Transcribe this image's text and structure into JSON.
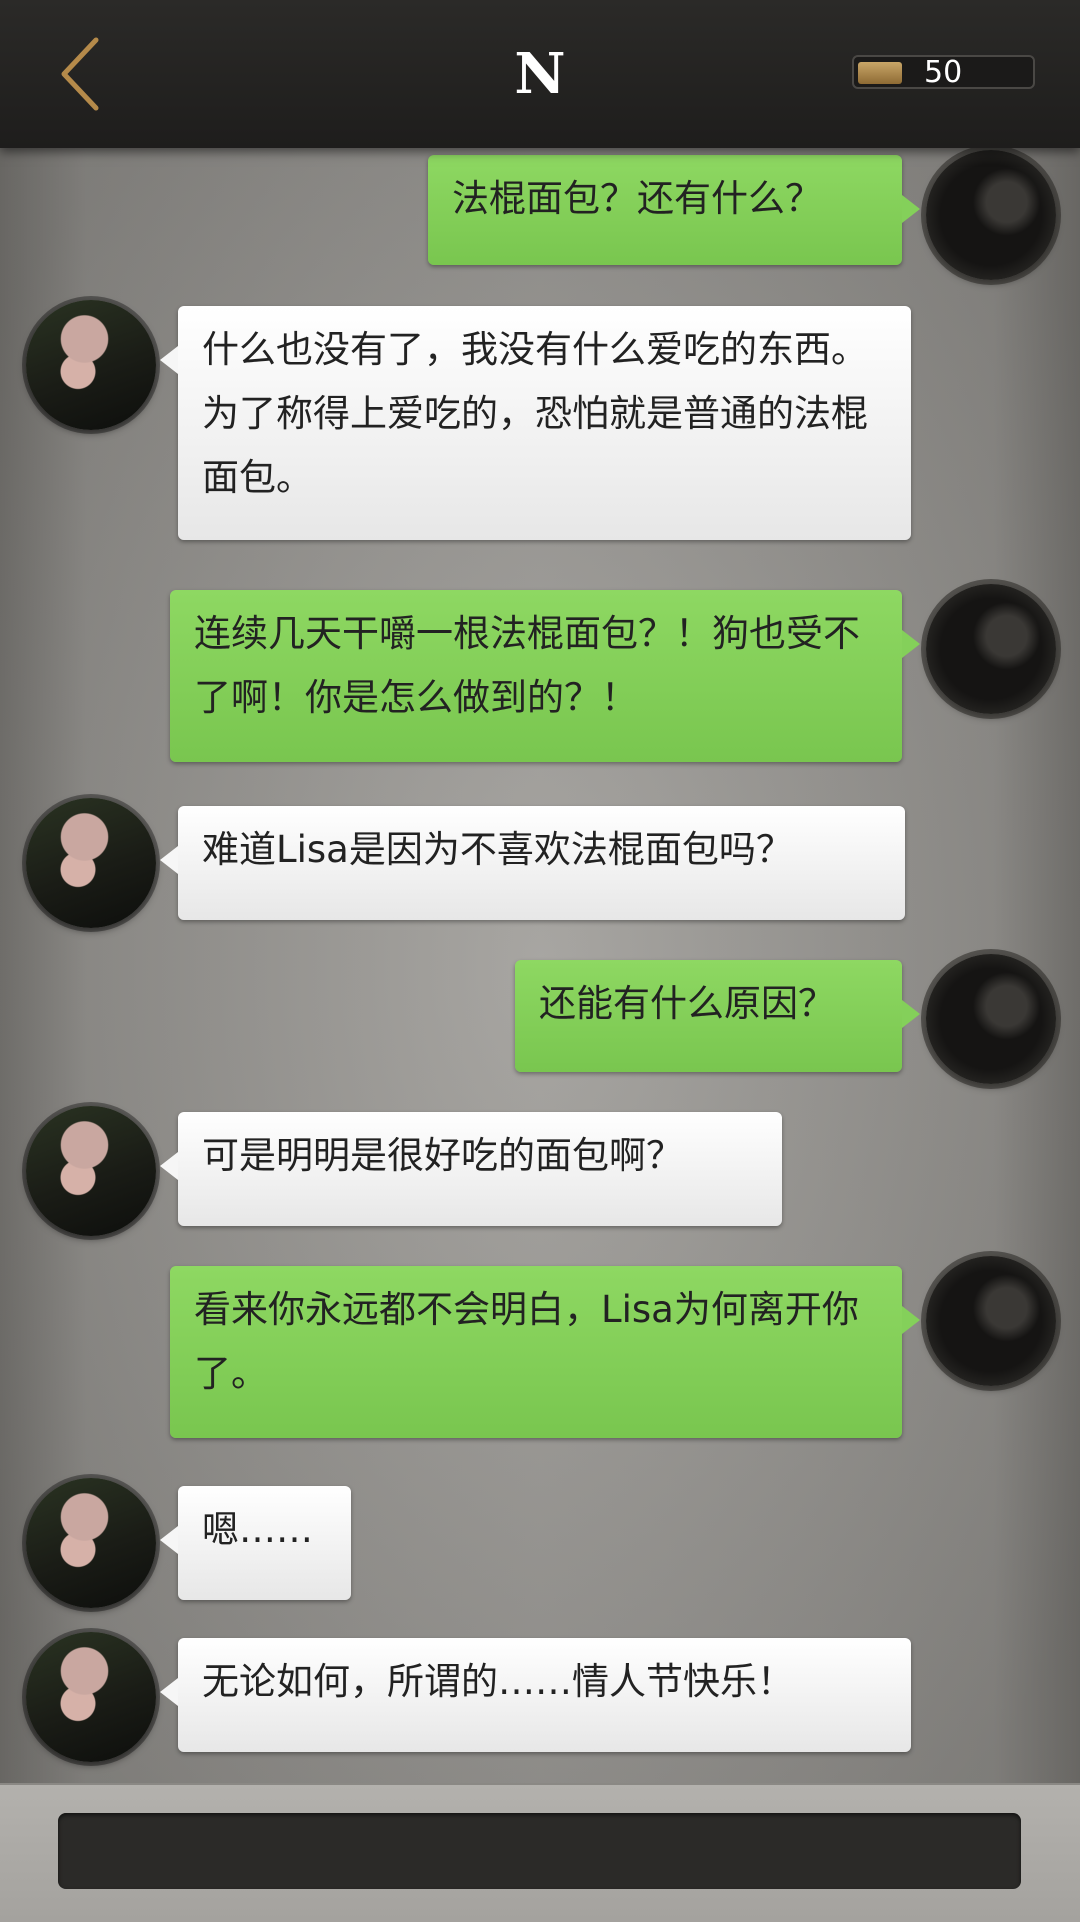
{
  "header": {
    "title": "N",
    "coin_count": "50"
  },
  "messages": [
    {
      "sender": "me",
      "text": "法棍面包？还有什么？"
    },
    {
      "sender": "npc",
      "text": "什么也没有了，我没有什么爱吃的东西。为了称得上爱吃的，恐怕就是普通的法棍面包。"
    },
    {
      "sender": "me",
      "text": "连续几天干嚼一根法棍面包？！狗也受不了啊！你是怎么做到的？！"
    },
    {
      "sender": "npc",
      "text": "难道Lisa是因为不喜欢法棍面包吗？"
    },
    {
      "sender": "me",
      "text": "还能有什么原因？"
    },
    {
      "sender": "npc",
      "text": "可是明明是很好吃的面包啊？"
    },
    {
      "sender": "me",
      "text": "看来你永远都不会明白，Lisa为何离开你了。"
    },
    {
      "sender": "npc",
      "text": "嗯……"
    },
    {
      "sender": "npc",
      "text": "无论如何，所谓的……情人节快乐！"
    }
  ],
  "input": {
    "value": ""
  },
  "colors": {
    "player_bubble": "#84d05a",
    "npc_bubble": "#f2f2f2",
    "header_bg": "#242322",
    "accent_back": "#b58a4a"
  },
  "icons": {
    "back": "chevron-left-icon",
    "coin": "coin-icon"
  }
}
